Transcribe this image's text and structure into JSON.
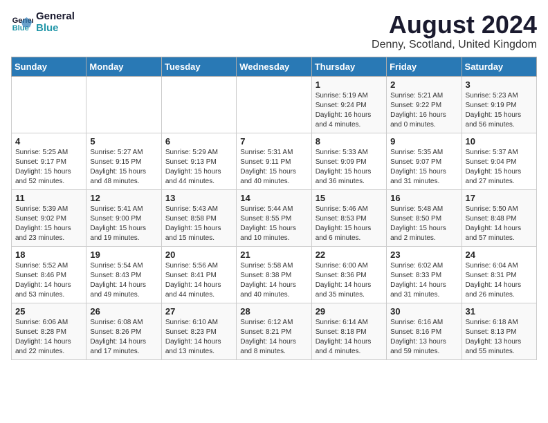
{
  "header": {
    "logo_line1": "General",
    "logo_line2": "Blue",
    "title": "August 2024",
    "subtitle": "Denny, Scotland, United Kingdom"
  },
  "weekdays": [
    "Sunday",
    "Monday",
    "Tuesday",
    "Wednesday",
    "Thursday",
    "Friday",
    "Saturday"
  ],
  "weeks": [
    [
      {
        "day": "",
        "info": ""
      },
      {
        "day": "",
        "info": ""
      },
      {
        "day": "",
        "info": ""
      },
      {
        "day": "",
        "info": ""
      },
      {
        "day": "1",
        "info": "Sunrise: 5:19 AM\nSunset: 9:24 PM\nDaylight: 16 hours\nand 4 minutes."
      },
      {
        "day": "2",
        "info": "Sunrise: 5:21 AM\nSunset: 9:22 PM\nDaylight: 16 hours\nand 0 minutes."
      },
      {
        "day": "3",
        "info": "Sunrise: 5:23 AM\nSunset: 9:19 PM\nDaylight: 15 hours\nand 56 minutes."
      }
    ],
    [
      {
        "day": "4",
        "info": "Sunrise: 5:25 AM\nSunset: 9:17 PM\nDaylight: 15 hours\nand 52 minutes."
      },
      {
        "day": "5",
        "info": "Sunrise: 5:27 AM\nSunset: 9:15 PM\nDaylight: 15 hours\nand 48 minutes."
      },
      {
        "day": "6",
        "info": "Sunrise: 5:29 AM\nSunset: 9:13 PM\nDaylight: 15 hours\nand 44 minutes."
      },
      {
        "day": "7",
        "info": "Sunrise: 5:31 AM\nSunset: 9:11 PM\nDaylight: 15 hours\nand 40 minutes."
      },
      {
        "day": "8",
        "info": "Sunrise: 5:33 AM\nSunset: 9:09 PM\nDaylight: 15 hours\nand 36 minutes."
      },
      {
        "day": "9",
        "info": "Sunrise: 5:35 AM\nSunset: 9:07 PM\nDaylight: 15 hours\nand 31 minutes."
      },
      {
        "day": "10",
        "info": "Sunrise: 5:37 AM\nSunset: 9:04 PM\nDaylight: 15 hours\nand 27 minutes."
      }
    ],
    [
      {
        "day": "11",
        "info": "Sunrise: 5:39 AM\nSunset: 9:02 PM\nDaylight: 15 hours\nand 23 minutes."
      },
      {
        "day": "12",
        "info": "Sunrise: 5:41 AM\nSunset: 9:00 PM\nDaylight: 15 hours\nand 19 minutes."
      },
      {
        "day": "13",
        "info": "Sunrise: 5:43 AM\nSunset: 8:58 PM\nDaylight: 15 hours\nand 15 minutes."
      },
      {
        "day": "14",
        "info": "Sunrise: 5:44 AM\nSunset: 8:55 PM\nDaylight: 15 hours\nand 10 minutes."
      },
      {
        "day": "15",
        "info": "Sunrise: 5:46 AM\nSunset: 8:53 PM\nDaylight: 15 hours\nand 6 minutes."
      },
      {
        "day": "16",
        "info": "Sunrise: 5:48 AM\nSunset: 8:50 PM\nDaylight: 15 hours\nand 2 minutes."
      },
      {
        "day": "17",
        "info": "Sunrise: 5:50 AM\nSunset: 8:48 PM\nDaylight: 14 hours\nand 57 minutes."
      }
    ],
    [
      {
        "day": "18",
        "info": "Sunrise: 5:52 AM\nSunset: 8:46 PM\nDaylight: 14 hours\nand 53 minutes."
      },
      {
        "day": "19",
        "info": "Sunrise: 5:54 AM\nSunset: 8:43 PM\nDaylight: 14 hours\nand 49 minutes."
      },
      {
        "day": "20",
        "info": "Sunrise: 5:56 AM\nSunset: 8:41 PM\nDaylight: 14 hours\nand 44 minutes."
      },
      {
        "day": "21",
        "info": "Sunrise: 5:58 AM\nSunset: 8:38 PM\nDaylight: 14 hours\nand 40 minutes."
      },
      {
        "day": "22",
        "info": "Sunrise: 6:00 AM\nSunset: 8:36 PM\nDaylight: 14 hours\nand 35 minutes."
      },
      {
        "day": "23",
        "info": "Sunrise: 6:02 AM\nSunset: 8:33 PM\nDaylight: 14 hours\nand 31 minutes."
      },
      {
        "day": "24",
        "info": "Sunrise: 6:04 AM\nSunset: 8:31 PM\nDaylight: 14 hours\nand 26 minutes."
      }
    ],
    [
      {
        "day": "25",
        "info": "Sunrise: 6:06 AM\nSunset: 8:28 PM\nDaylight: 14 hours\nand 22 minutes."
      },
      {
        "day": "26",
        "info": "Sunrise: 6:08 AM\nSunset: 8:26 PM\nDaylight: 14 hours\nand 17 minutes."
      },
      {
        "day": "27",
        "info": "Sunrise: 6:10 AM\nSunset: 8:23 PM\nDaylight: 14 hours\nand 13 minutes."
      },
      {
        "day": "28",
        "info": "Sunrise: 6:12 AM\nSunset: 8:21 PM\nDaylight: 14 hours\nand 8 minutes."
      },
      {
        "day": "29",
        "info": "Sunrise: 6:14 AM\nSunset: 8:18 PM\nDaylight: 14 hours\nand 4 minutes."
      },
      {
        "day": "30",
        "info": "Sunrise: 6:16 AM\nSunset: 8:16 PM\nDaylight: 13 hours\nand 59 minutes."
      },
      {
        "day": "31",
        "info": "Sunrise: 6:18 AM\nSunset: 8:13 PM\nDaylight: 13 hours\nand 55 minutes."
      }
    ]
  ]
}
